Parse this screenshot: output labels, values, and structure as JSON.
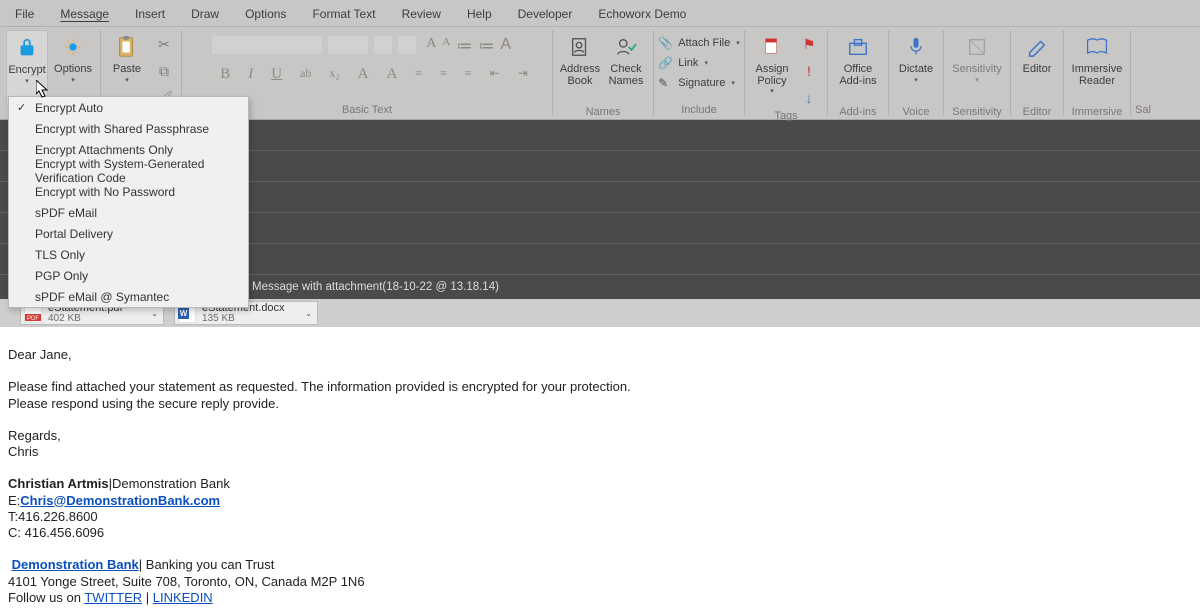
{
  "tabs": [
    "File",
    "Message",
    "Insert",
    "Draw",
    "Options",
    "Format Text",
    "Review",
    "Help",
    "Developer",
    "Echoworx Demo"
  ],
  "activeTab": "Message",
  "ribbon": {
    "encrypt": {
      "label": "Encrypt"
    },
    "options": {
      "label": "Options"
    },
    "paste": {
      "label": "Paste"
    },
    "basicText": {
      "label": "Basic Text",
      "buttons": [
        "B",
        "I",
        "U",
        "ab",
        "x",
        "A",
        "A"
      ]
    },
    "names": {
      "label": "Names",
      "address": "Address\nBook",
      "check": "Check\nNames"
    },
    "include": {
      "label": "Include",
      "attach": "Attach File",
      "link": "Link",
      "signature": "Signature"
    },
    "tags": {
      "label": "Tags",
      "assign": "Assign\nPolicy"
    },
    "addins": {
      "label": "Add-ins",
      "office": "Office\nAdd-ins"
    },
    "voice": {
      "label": "Voice",
      "dictate": "Dictate"
    },
    "sensitivity": {
      "label": "Sensitivity",
      "btn": "Sensitivity"
    },
    "editor": {
      "label": "Editor",
      "btn": "Editor"
    },
    "immersive": {
      "label": "Immersive",
      "btn": "Immersive\nReader"
    },
    "sal": {
      "label": "Sal"
    }
  },
  "dropdown": [
    "Encrypt Auto",
    "Encrypt with Shared Passphrase",
    "Encrypt Attachments Only",
    "Encrypt with System-Generated Verification Code",
    "Encrypt with No Password",
    "sPDF eMail",
    "Portal Delivery",
    "TLS Only",
    "PGP Only",
    "sPDF eMail @ Symantec"
  ],
  "messageRow": {
    "pre": "Message with attachment ",
    "ts": "(18-10-22 @ 13.18.14)"
  },
  "attachments": [
    {
      "name": "eStatement.pdf",
      "size": "402 KB",
      "type": "pdf"
    },
    {
      "name": "eStatement.docx",
      "size": "135 KB",
      "type": "docx"
    }
  ],
  "body": {
    "greeting": "Dear Jane,",
    "p1": "Please find attached your statement as requested. The information provided is encrypted for your protection.",
    "p2": "Please respond using the secure reply provide.",
    "regards": "Regards,",
    "name": "Chris",
    "sig": {
      "name": "Christian Artmis",
      "sep": "|",
      "company": "Demonstration Bank",
      "emailLabel": "E:",
      "email": "Chris@DemonstrationBank.com",
      "tel": "T:416.226.8600",
      "cell": "C: 416.456.6096",
      "slogan": " Banking you can Trust",
      "address": "4101 Yonge Street, Suite 708, Toronto, ON, Canada M2P 1N6",
      "followPre": "Follow us on ",
      "twitter": "TWITTER",
      "bar": " | ",
      "linkedin": "LINKEDIN"
    }
  }
}
